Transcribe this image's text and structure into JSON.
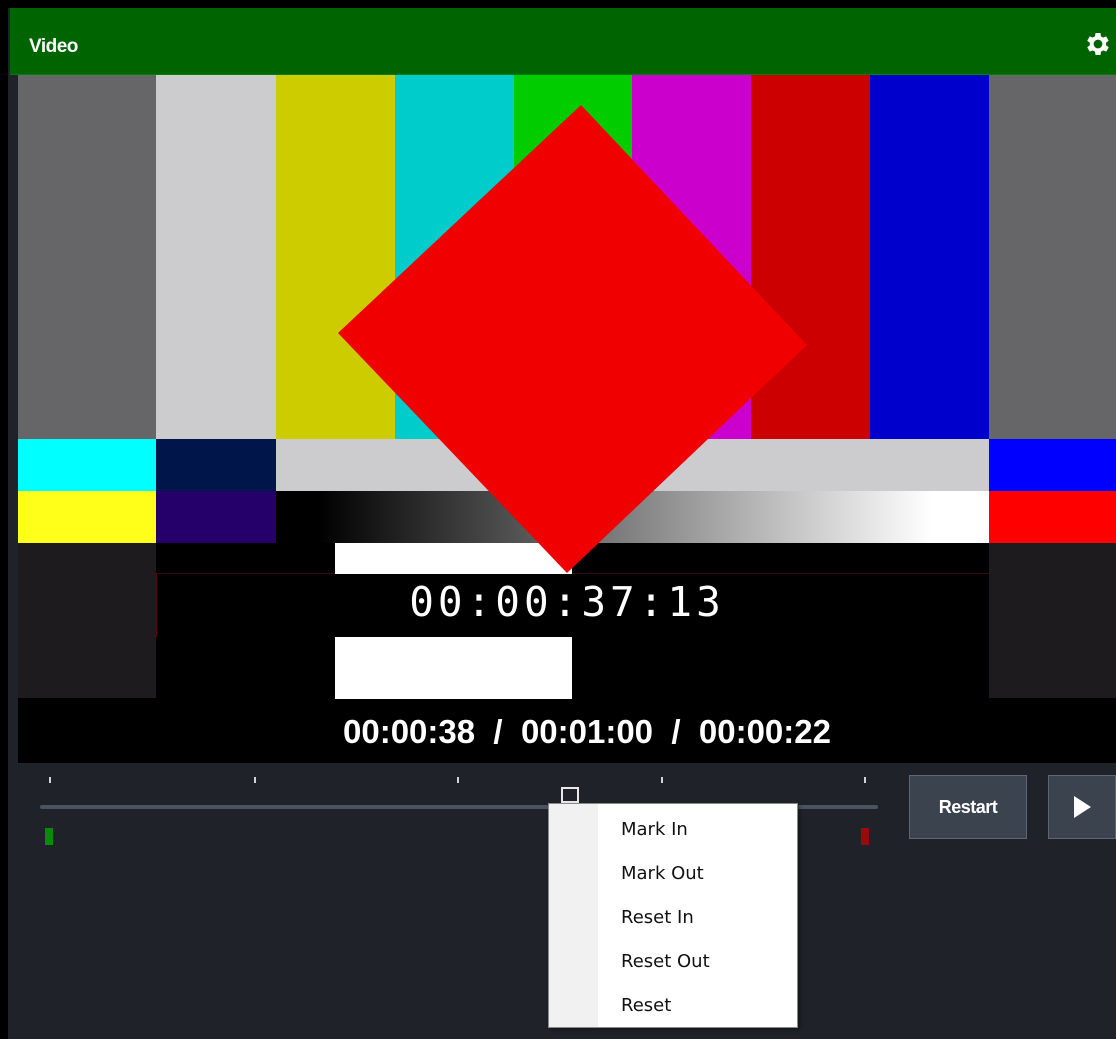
{
  "window": {
    "title": "Video",
    "settings_icon": "gear-icon"
  },
  "video": {
    "timecode": "00:00:37:13",
    "timeline_readout": "00:00:38  /  00:01:00  /  00:00:22",
    "colors": {
      "gray": "#666567",
      "light_gray": "#cccbcd",
      "yellow": "#cccc00",
      "cyan": "#00cccc",
      "green": "#00cc00",
      "magenta": "#cc00cc",
      "red": "#cc0000",
      "blue": "#0000cc",
      "bright_cyan": "#00ffff",
      "navy": "#001549",
      "bright_yellow": "#ffff1a",
      "purple": "#26006a",
      "bright_blue": "#0000ff",
      "bright_red": "#ff0000",
      "diamond": "#f00000",
      "pluge": "#1d1b1e"
    }
  },
  "timeline": {
    "progress_fraction": 0.633,
    "in_color": "#0a8a0a",
    "out_color": "#9a0a0a"
  },
  "controls": {
    "restart_label": "Restart",
    "play_icon": "play-icon"
  },
  "context_menu": {
    "items": [
      {
        "label": "Mark In"
      },
      {
        "label": "Mark Out"
      },
      {
        "label": "Reset In"
      },
      {
        "label": "Reset Out"
      },
      {
        "label": "Reset"
      }
    ]
  }
}
